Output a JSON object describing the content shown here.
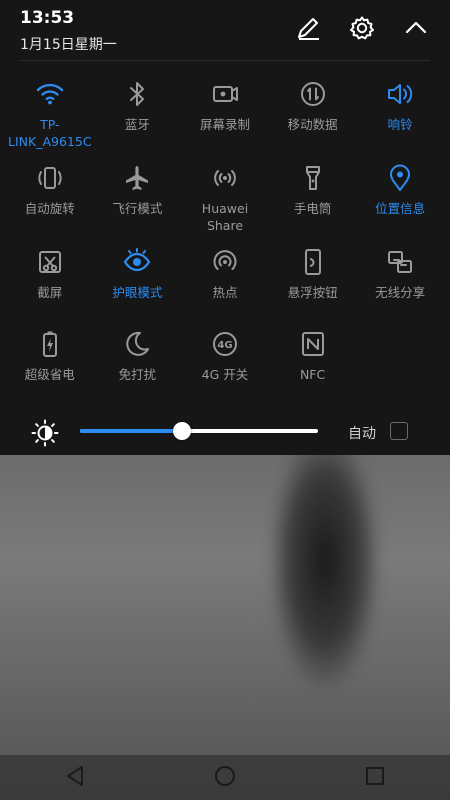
{
  "status": {
    "time": "13:53",
    "date": "1月15日星期一"
  },
  "colors": {
    "accent": "#2d8cf0",
    "inactive": "#9a9a9a",
    "panel": "#161616"
  },
  "tiles": [
    {
      "id": "wifi",
      "label": "TP-LINK_A9615C",
      "icon": "wifi-icon",
      "active": true
    },
    {
      "id": "bluetooth",
      "label": "蓝牙",
      "icon": "bluetooth-icon",
      "active": false
    },
    {
      "id": "screen-record",
      "label": "屏幕录制",
      "icon": "screen-record-icon",
      "active": false
    },
    {
      "id": "mobile-data",
      "label": "移动数据",
      "icon": "mobile-data-icon",
      "active": false
    },
    {
      "id": "sound",
      "label": "响铃",
      "icon": "speaker-icon",
      "active": true
    },
    {
      "id": "auto-rotate",
      "label": "自动旋转",
      "icon": "rotate-icon",
      "active": false
    },
    {
      "id": "airplane",
      "label": "飞行模式",
      "icon": "airplane-icon",
      "active": false
    },
    {
      "id": "huawei-share",
      "label": "Huawei Share",
      "icon": "huawei-share-icon",
      "active": false
    },
    {
      "id": "flashlight",
      "label": "手电筒",
      "icon": "flashlight-icon",
      "active": false
    },
    {
      "id": "location",
      "label": "位置信息",
      "icon": "location-icon",
      "active": true
    },
    {
      "id": "screenshot",
      "label": "截屏",
      "icon": "screenshot-icon",
      "active": false
    },
    {
      "id": "eye-comfort",
      "label": "护眼模式",
      "icon": "eye-icon",
      "active": true
    },
    {
      "id": "hotspot",
      "label": "热点",
      "icon": "hotspot-icon",
      "active": false
    },
    {
      "id": "floating-button",
      "label": "悬浮按钮",
      "icon": "floating-button-icon",
      "active": false
    },
    {
      "id": "wireless-share",
      "label": "无线分享",
      "icon": "wireless-share-icon",
      "active": false
    },
    {
      "id": "power-saver",
      "label": "超级省电",
      "icon": "battery-icon",
      "active": false
    },
    {
      "id": "do-not-disturb",
      "label": "免打扰",
      "icon": "moon-icon",
      "active": false
    },
    {
      "id": "4g",
      "label": "4G 开关",
      "icon": "4g-icon",
      "active": false
    },
    {
      "id": "nfc",
      "label": "NFC",
      "icon": "nfc-icon",
      "active": false
    }
  ],
  "brightness": {
    "value": 0.43,
    "auto_label": "自动",
    "auto_checked": false
  }
}
